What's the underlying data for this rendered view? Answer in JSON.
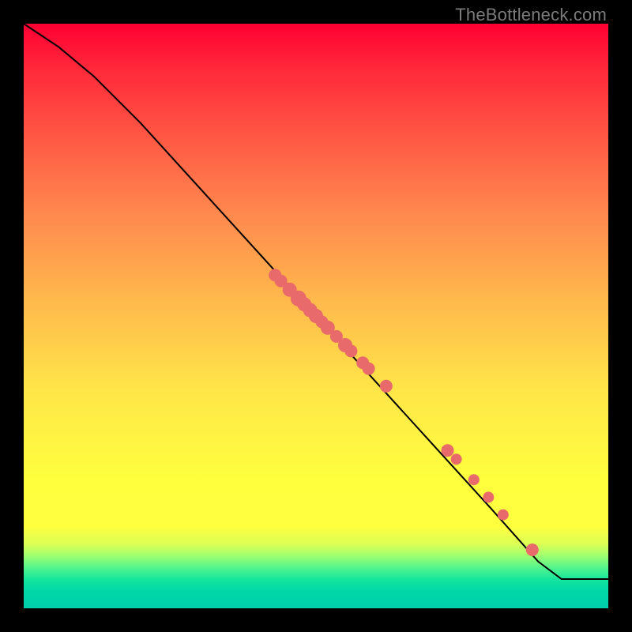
{
  "watermark": "TheBottleneck.com",
  "colors": {
    "dot": "#e86a6a",
    "curve": "#000000",
    "frame": "#000000"
  },
  "chart_data": {
    "type": "line",
    "title": "",
    "xlabel": "",
    "ylabel": "",
    "xlim": [
      0,
      100
    ],
    "ylim": [
      0,
      100
    ],
    "grid": false,
    "series": [
      {
        "name": "curve",
        "x": [
          0,
          6,
          12,
          20,
          30,
          40,
          50,
          60,
          70,
          80,
          88,
          92,
          100
        ],
        "y": [
          100,
          96,
          91,
          83,
          72,
          61,
          50,
          39,
          28,
          17,
          8,
          5,
          5
        ]
      }
    ],
    "points": [
      {
        "x": 43,
        "y": 57
      },
      {
        "x": 44,
        "y": 56
      },
      {
        "x": 45.5,
        "y": 54.5
      },
      {
        "x": 47,
        "y": 53
      },
      {
        "x": 48,
        "y": 52
      },
      {
        "x": 49,
        "y": 51
      },
      {
        "x": 50,
        "y": 50
      },
      {
        "x": 51,
        "y": 49
      },
      {
        "x": 52,
        "y": 48
      },
      {
        "x": 53.5,
        "y": 46.5
      },
      {
        "x": 55,
        "y": 45
      },
      {
        "x": 56,
        "y": 44
      },
      {
        "x": 58,
        "y": 42
      },
      {
        "x": 59,
        "y": 41
      },
      {
        "x": 62,
        "y": 38
      },
      {
        "x": 72.5,
        "y": 27
      },
      {
        "x": 74,
        "y": 25.5
      },
      {
        "x": 77,
        "y": 22
      },
      {
        "x": 79.5,
        "y": 19
      },
      {
        "x": 82,
        "y": 16
      },
      {
        "x": 87,
        "y": 10
      }
    ],
    "point_radii": [
      8,
      8,
      9,
      10,
      9,
      9,
      9,
      8,
      9,
      8,
      9,
      8,
      8,
      8,
      8,
      8,
      7,
      7,
      7,
      7,
      8
    ]
  }
}
